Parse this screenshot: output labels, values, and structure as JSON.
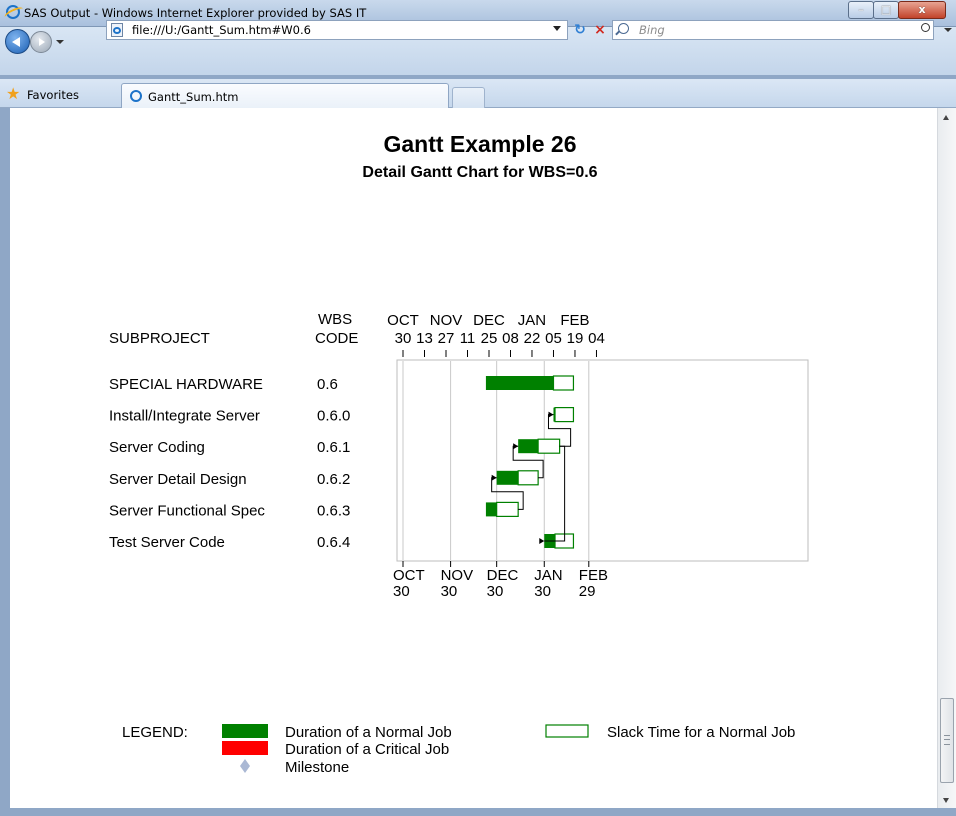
{
  "window": {
    "title": "SAS Output - Windows Internet Explorer provided by SAS IT",
    "minimize_label": "–",
    "maximize_label": "□",
    "close_label": "x"
  },
  "addressbar": {
    "url": "file:///U:/Gantt_Sum.htm#W0.6",
    "search_placeholder": "Bing"
  },
  "tabbar": {
    "favorites_label": "Favorites",
    "tab_label": "Gantt_Sum.htm"
  },
  "colors": {
    "normal_job": "#008000",
    "critical_job": "#ff0000",
    "milestone": "#aab8d4",
    "slack_border": "#008000"
  },
  "chart_data": {
    "type": "gantt",
    "title": "Gantt Example 26",
    "subtitle": "Detail Gantt Chart for WBS=0.6",
    "columns": {
      "subproject_header": "SUBPROJECT",
      "wbs_header_line1": "WBS",
      "wbs_header_line2": "CODE"
    },
    "top_axis": {
      "months": [
        "OCT",
        "NOV",
        "DEC",
        "JAN",
        "FEB"
      ],
      "days": [
        "30",
        "13",
        "27",
        "11",
        "25",
        "08",
        "22",
        "05",
        "19",
        "04"
      ]
    },
    "bottom_axis": {
      "months": [
        "OCT",
        "NOV",
        "DEC",
        "JAN",
        "FEB"
      ],
      "days": [
        "30",
        "30",
        "30",
        "30",
        "29"
      ]
    },
    "tasks": [
      {
        "name": "SPECIAL HARDWARE",
        "wbs": "0.6",
        "start": "2006-12-23",
        "finish": "2007-02-05",
        "slack_finish": "2007-02-18"
      },
      {
        "name": "Install/Integrate Server",
        "wbs": "0.6.0",
        "start": "2007-02-05",
        "finish": "2007-02-06",
        "slack_finish": "2007-02-18"
      },
      {
        "name": "Server Coding",
        "wbs": "0.6.1",
        "start": "2007-01-13",
        "finish": "2007-01-26",
        "slack_finish": "2007-02-09"
      },
      {
        "name": "Server Detail Design",
        "wbs": "0.6.2",
        "start": "2006-12-30",
        "finish": "2007-01-13",
        "slack_finish": "2007-01-26"
      },
      {
        "name": "Server Functional Spec",
        "wbs": "0.6.3",
        "start": "2006-12-23",
        "finish": "2006-12-30",
        "slack_finish": "2007-01-13"
      },
      {
        "name": "Test Server Code",
        "wbs": "0.6.4",
        "start": "2007-01-30",
        "finish": "2007-02-06",
        "slack_finish": "2007-02-18"
      }
    ],
    "links": [
      {
        "from": "Server Functional Spec",
        "to": "Server Detail Design"
      },
      {
        "from": "Server Detail Design",
        "to": "Server Coding"
      },
      {
        "from": "Server Coding",
        "to": "Test Server Code"
      },
      {
        "from": "Server Coding",
        "to": "Install/Integrate Server"
      }
    ],
    "legend": {
      "title": "LEGEND:",
      "items": [
        {
          "label": "Duration of a Normal Job",
          "symbol": "normal"
        },
        {
          "label": "Duration of a Critical Job",
          "symbol": "critical"
        },
        {
          "label": "Milestone",
          "symbol": "milestone"
        },
        {
          "label": "Slack Time for a Normal Job",
          "symbol": "slack"
        }
      ]
    }
  }
}
